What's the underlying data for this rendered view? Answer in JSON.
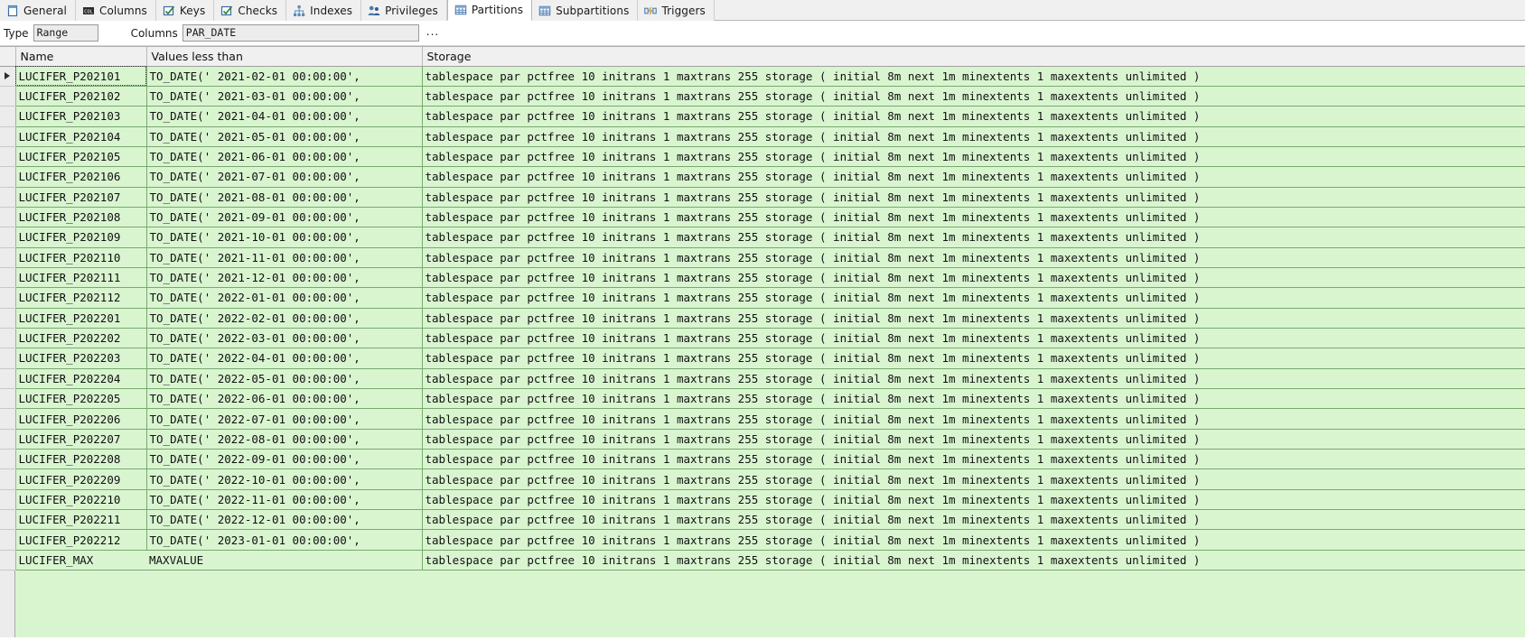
{
  "tabs": [
    {
      "label": "General",
      "icon": "page-icon",
      "active": false
    },
    {
      "label": "Columns",
      "icon": "column-icon",
      "active": false
    },
    {
      "label": "Keys",
      "icon": "key-check-icon",
      "active": false
    },
    {
      "label": "Checks",
      "icon": "check-box-icon",
      "active": false
    },
    {
      "label": "Indexes",
      "icon": "index-tree-icon",
      "active": false
    },
    {
      "label": "Privileges",
      "icon": "people-icon",
      "active": false
    },
    {
      "label": "Partitions",
      "icon": "table-grid-icon",
      "active": true
    },
    {
      "label": "Subpartitions",
      "icon": "table-grid-icon",
      "active": false
    },
    {
      "label": "Triggers",
      "icon": "trigger-icon",
      "active": false
    }
  ],
  "properties": {
    "type_label": "Type",
    "type_value": "Range",
    "columns_label": "Columns",
    "columns_value": "PAR_DATE",
    "more_button": "..."
  },
  "grid": {
    "columns": [
      "Name",
      "Values less than",
      "Storage"
    ],
    "selected_row_index": 0,
    "storage_common": "tablespace par pctfree 10 initrans 1 maxtrans 255 storage ( initial 8m next 1m minextents 1 maxextents unlimited )",
    "rows": [
      {
        "name": "LUCIFER_P202101",
        "values": "TO_DATE(' 2021-02-01 00:00:00',",
        "storage": "tablespace par pctfree 10 initrans 1 maxtrans 255 storage ( initial 8m next 1m minextents 1 maxextents unlimited )"
      },
      {
        "name": "LUCIFER_P202102",
        "values": "TO_DATE(' 2021-03-01 00:00:00',",
        "storage": "tablespace par pctfree 10 initrans 1 maxtrans 255 storage ( initial 8m next 1m minextents 1 maxextents unlimited )"
      },
      {
        "name": "LUCIFER_P202103",
        "values": "TO_DATE(' 2021-04-01 00:00:00',",
        "storage": "tablespace par pctfree 10 initrans 1 maxtrans 255 storage ( initial 8m next 1m minextents 1 maxextents unlimited )"
      },
      {
        "name": "LUCIFER_P202104",
        "values": "TO_DATE(' 2021-05-01 00:00:00',",
        "storage": "tablespace par pctfree 10 initrans 1 maxtrans 255 storage ( initial 8m next 1m minextents 1 maxextents unlimited )"
      },
      {
        "name": "LUCIFER_P202105",
        "values": "TO_DATE(' 2021-06-01 00:00:00',",
        "storage": "tablespace par pctfree 10 initrans 1 maxtrans 255 storage ( initial 8m next 1m minextents 1 maxextents unlimited )"
      },
      {
        "name": "LUCIFER_P202106",
        "values": "TO_DATE(' 2021-07-01 00:00:00',",
        "storage": "tablespace par pctfree 10 initrans 1 maxtrans 255 storage ( initial 8m next 1m minextents 1 maxextents unlimited )"
      },
      {
        "name": "LUCIFER_P202107",
        "values": "TO_DATE(' 2021-08-01 00:00:00',",
        "storage": "tablespace par pctfree 10 initrans 1 maxtrans 255 storage ( initial 8m next 1m minextents 1 maxextents unlimited )"
      },
      {
        "name": "LUCIFER_P202108",
        "values": "TO_DATE(' 2021-09-01 00:00:00',",
        "storage": "tablespace par pctfree 10 initrans 1 maxtrans 255 storage ( initial 8m next 1m minextents 1 maxextents unlimited )"
      },
      {
        "name": "LUCIFER_P202109",
        "values": "TO_DATE(' 2021-10-01 00:00:00',",
        "storage": "tablespace par pctfree 10 initrans 1 maxtrans 255 storage ( initial 8m next 1m minextents 1 maxextents unlimited )"
      },
      {
        "name": "LUCIFER_P202110",
        "values": "TO_DATE(' 2021-11-01 00:00:00',",
        "storage": "tablespace par pctfree 10 initrans 1 maxtrans 255 storage ( initial 8m next 1m minextents 1 maxextents unlimited )"
      },
      {
        "name": "LUCIFER_P202111",
        "values": "TO_DATE(' 2021-12-01 00:00:00',",
        "storage": "tablespace par pctfree 10 initrans 1 maxtrans 255 storage ( initial 8m next 1m minextents 1 maxextents unlimited )"
      },
      {
        "name": "LUCIFER_P202112",
        "values": "TO_DATE(' 2022-01-01 00:00:00',",
        "storage": "tablespace par pctfree 10 initrans 1 maxtrans 255 storage ( initial 8m next 1m minextents 1 maxextents unlimited )"
      },
      {
        "name": "LUCIFER_P202201",
        "values": "TO_DATE(' 2022-02-01 00:00:00',",
        "storage": "tablespace par pctfree 10 initrans 1 maxtrans 255 storage ( initial 8m next 1m minextents 1 maxextents unlimited )"
      },
      {
        "name": "LUCIFER_P202202",
        "values": "TO_DATE(' 2022-03-01 00:00:00',",
        "storage": "tablespace par pctfree 10 initrans 1 maxtrans 255 storage ( initial 8m next 1m minextents 1 maxextents unlimited )"
      },
      {
        "name": "LUCIFER_P202203",
        "values": "TO_DATE(' 2022-04-01 00:00:00',",
        "storage": "tablespace par pctfree 10 initrans 1 maxtrans 255 storage ( initial 8m next 1m minextents 1 maxextents unlimited )"
      },
      {
        "name": "LUCIFER_P202204",
        "values": "TO_DATE(' 2022-05-01 00:00:00',",
        "storage": "tablespace par pctfree 10 initrans 1 maxtrans 255 storage ( initial 8m next 1m minextents 1 maxextents unlimited )"
      },
      {
        "name": "LUCIFER_P202205",
        "values": "TO_DATE(' 2022-06-01 00:00:00',",
        "storage": "tablespace par pctfree 10 initrans 1 maxtrans 255 storage ( initial 8m next 1m minextents 1 maxextents unlimited )"
      },
      {
        "name": "LUCIFER_P202206",
        "values": "TO_DATE(' 2022-07-01 00:00:00',",
        "storage": "tablespace par pctfree 10 initrans 1 maxtrans 255 storage ( initial 8m next 1m minextents 1 maxextents unlimited )"
      },
      {
        "name": "LUCIFER_P202207",
        "values": "TO_DATE(' 2022-08-01 00:00:00',",
        "storage": "tablespace par pctfree 10 initrans 1 maxtrans 255 storage ( initial 8m next 1m minextents 1 maxextents unlimited )"
      },
      {
        "name": "LUCIFER_P202208",
        "values": "TO_DATE(' 2022-09-01 00:00:00',",
        "storage": "tablespace par pctfree 10 initrans 1 maxtrans 255 storage ( initial 8m next 1m minextents 1 maxextents unlimited )"
      },
      {
        "name": "LUCIFER_P202209",
        "values": "TO_DATE(' 2022-10-01 00:00:00',",
        "storage": "tablespace par pctfree 10 initrans 1 maxtrans 255 storage ( initial 8m next 1m minextents 1 maxextents unlimited )"
      },
      {
        "name": "LUCIFER_P202210",
        "values": "TO_DATE(' 2022-11-01 00:00:00',",
        "storage": "tablespace par pctfree 10 initrans 1 maxtrans 255 storage ( initial 8m next 1m minextents 1 maxextents unlimited )"
      },
      {
        "name": "LUCIFER_P202211",
        "values": "TO_DATE(' 2022-12-01 00:00:00',",
        "storage": "tablespace par pctfree 10 initrans 1 maxtrans 255 storage ( initial 8m next 1m minextents 1 maxextents unlimited )"
      },
      {
        "name": "LUCIFER_P202212",
        "values": "TO_DATE(' 2023-01-01 00:00:00',",
        "storage": "tablespace par pctfree 10 initrans 1 maxtrans 255 storage ( initial 8m next 1m minextents 1 maxextents unlimited )"
      },
      {
        "name": "LUCIFER_MAX",
        "values": "MAXVALUE",
        "storage": "tablespace par pctfree 10 initrans 1 maxtrans 255 storage ( initial 8m next 1m minextents 1 maxextents unlimited )"
      }
    ]
  },
  "colors": {
    "grid_background": "#d9f5d0",
    "grid_line": "#7aa870",
    "header_background": "#f0f0f0",
    "gutter_background": "#ececec",
    "text": "#111111"
  }
}
